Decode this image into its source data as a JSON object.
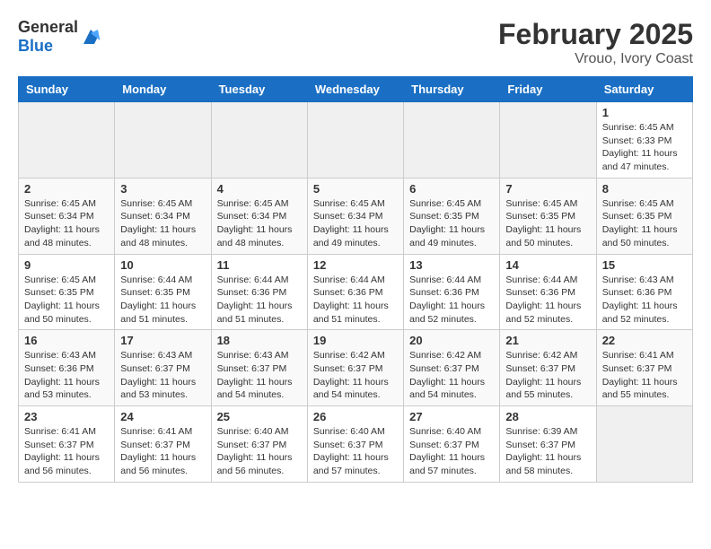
{
  "header": {
    "logo_general": "General",
    "logo_blue": "Blue",
    "month": "February 2025",
    "location": "Vrouo, Ivory Coast"
  },
  "weekdays": [
    "Sunday",
    "Monday",
    "Tuesday",
    "Wednesday",
    "Thursday",
    "Friday",
    "Saturday"
  ],
  "weeks": [
    [
      {
        "day": "",
        "info": ""
      },
      {
        "day": "",
        "info": ""
      },
      {
        "day": "",
        "info": ""
      },
      {
        "day": "",
        "info": ""
      },
      {
        "day": "",
        "info": ""
      },
      {
        "day": "",
        "info": ""
      },
      {
        "day": "1",
        "info": "Sunrise: 6:45 AM\nSunset: 6:33 PM\nDaylight: 11 hours and 47 minutes."
      }
    ],
    [
      {
        "day": "2",
        "info": "Sunrise: 6:45 AM\nSunset: 6:34 PM\nDaylight: 11 hours and 48 minutes."
      },
      {
        "day": "3",
        "info": "Sunrise: 6:45 AM\nSunset: 6:34 PM\nDaylight: 11 hours and 48 minutes."
      },
      {
        "day": "4",
        "info": "Sunrise: 6:45 AM\nSunset: 6:34 PM\nDaylight: 11 hours and 48 minutes."
      },
      {
        "day": "5",
        "info": "Sunrise: 6:45 AM\nSunset: 6:34 PM\nDaylight: 11 hours and 49 minutes."
      },
      {
        "day": "6",
        "info": "Sunrise: 6:45 AM\nSunset: 6:35 PM\nDaylight: 11 hours and 49 minutes."
      },
      {
        "day": "7",
        "info": "Sunrise: 6:45 AM\nSunset: 6:35 PM\nDaylight: 11 hours and 50 minutes."
      },
      {
        "day": "8",
        "info": "Sunrise: 6:45 AM\nSunset: 6:35 PM\nDaylight: 11 hours and 50 minutes."
      }
    ],
    [
      {
        "day": "9",
        "info": "Sunrise: 6:45 AM\nSunset: 6:35 PM\nDaylight: 11 hours and 50 minutes."
      },
      {
        "day": "10",
        "info": "Sunrise: 6:44 AM\nSunset: 6:35 PM\nDaylight: 11 hours and 51 minutes."
      },
      {
        "day": "11",
        "info": "Sunrise: 6:44 AM\nSunset: 6:36 PM\nDaylight: 11 hours and 51 minutes."
      },
      {
        "day": "12",
        "info": "Sunrise: 6:44 AM\nSunset: 6:36 PM\nDaylight: 11 hours and 51 minutes."
      },
      {
        "day": "13",
        "info": "Sunrise: 6:44 AM\nSunset: 6:36 PM\nDaylight: 11 hours and 52 minutes."
      },
      {
        "day": "14",
        "info": "Sunrise: 6:44 AM\nSunset: 6:36 PM\nDaylight: 11 hours and 52 minutes."
      },
      {
        "day": "15",
        "info": "Sunrise: 6:43 AM\nSunset: 6:36 PM\nDaylight: 11 hours and 52 minutes."
      }
    ],
    [
      {
        "day": "16",
        "info": "Sunrise: 6:43 AM\nSunset: 6:36 PM\nDaylight: 11 hours and 53 minutes."
      },
      {
        "day": "17",
        "info": "Sunrise: 6:43 AM\nSunset: 6:37 PM\nDaylight: 11 hours and 53 minutes."
      },
      {
        "day": "18",
        "info": "Sunrise: 6:43 AM\nSunset: 6:37 PM\nDaylight: 11 hours and 54 minutes."
      },
      {
        "day": "19",
        "info": "Sunrise: 6:42 AM\nSunset: 6:37 PM\nDaylight: 11 hours and 54 minutes."
      },
      {
        "day": "20",
        "info": "Sunrise: 6:42 AM\nSunset: 6:37 PM\nDaylight: 11 hours and 54 minutes."
      },
      {
        "day": "21",
        "info": "Sunrise: 6:42 AM\nSunset: 6:37 PM\nDaylight: 11 hours and 55 minutes."
      },
      {
        "day": "22",
        "info": "Sunrise: 6:41 AM\nSunset: 6:37 PM\nDaylight: 11 hours and 55 minutes."
      }
    ],
    [
      {
        "day": "23",
        "info": "Sunrise: 6:41 AM\nSunset: 6:37 PM\nDaylight: 11 hours and 56 minutes."
      },
      {
        "day": "24",
        "info": "Sunrise: 6:41 AM\nSunset: 6:37 PM\nDaylight: 11 hours and 56 minutes."
      },
      {
        "day": "25",
        "info": "Sunrise: 6:40 AM\nSunset: 6:37 PM\nDaylight: 11 hours and 56 minutes."
      },
      {
        "day": "26",
        "info": "Sunrise: 6:40 AM\nSunset: 6:37 PM\nDaylight: 11 hours and 57 minutes."
      },
      {
        "day": "27",
        "info": "Sunrise: 6:40 AM\nSunset: 6:37 PM\nDaylight: 11 hours and 57 minutes."
      },
      {
        "day": "28",
        "info": "Sunrise: 6:39 AM\nSunset: 6:37 PM\nDaylight: 11 hours and 58 minutes."
      },
      {
        "day": "",
        "info": ""
      }
    ]
  ]
}
